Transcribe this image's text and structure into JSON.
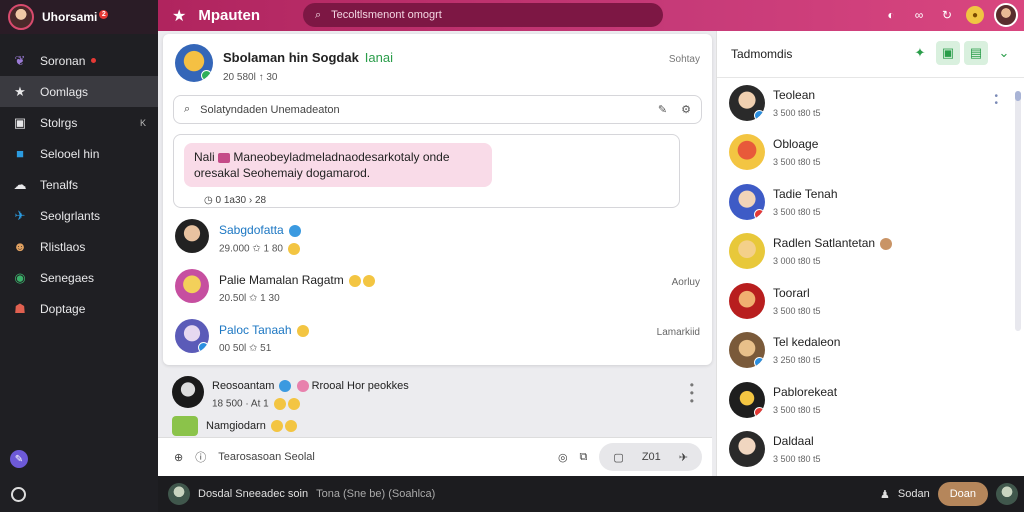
{
  "colors": {
    "accent": "#c63a78",
    "sidebar_bg": "#1f1f23",
    "green": "#2a9d4a",
    "link_blue": "#1c77c3"
  },
  "sidebar": {
    "user_name": "Uhorsami",
    "user_badge": "2",
    "items": [
      {
        "label": "Soronan",
        "icon": "feather-icon"
      },
      {
        "label": "Oomlags",
        "icon": "star-icon"
      },
      {
        "label": "Stolrgs",
        "icon": "image-icon",
        "tag": "K"
      },
      {
        "label": "Selooel hin",
        "icon": "app-icon"
      },
      {
        "label": "Tenalfs",
        "icon": "paw-icon"
      },
      {
        "label": "Seolgrlants",
        "icon": "bird-icon"
      },
      {
        "label": "Rlistlaos",
        "icon": "people-icon"
      },
      {
        "label": "Senegaes",
        "icon": "globe-icon"
      },
      {
        "label": "Doptage",
        "icon": "mask-icon"
      }
    ]
  },
  "topbar": {
    "title": "Mpauten",
    "search_placeholder": "Tecoltlsmenont omogrt"
  },
  "post": {
    "author": "Sbolaman hin Sogdak",
    "tag": "Ianai",
    "meta": "20 580l ↑ 30",
    "time": "Sohtay",
    "input_placeholder": "Solatyndaden Unemadeaton",
    "quote_lead": "Nali",
    "quote_text": "Maneobeyladmeladnaodesarkotaly onde oresakal Seohemaiy dogamarod.",
    "quote_meta": "0 1a30 › 28"
  },
  "comments": [
    {
      "name": "Sabgdofatta",
      "meta": "29.000 ✩ 1 80",
      "time": ""
    },
    {
      "name": "Palie Mamalan Ragatm",
      "meta": "20.50l ✩ 1 30",
      "time": "Aorluy"
    },
    {
      "name": "Paloc Tanaah",
      "meta": "00 50l ✩ 51",
      "time": "Lamarkiid"
    }
  ],
  "lower": [
    {
      "name": "Reosoantam",
      "extra": "Rrooal Hor peokkes",
      "meta": "18 500 · At 1"
    },
    {
      "name": "Namgiodarn",
      "extra": "",
      "meta": ""
    }
  ],
  "composer": {
    "placeholder": "Tearosasoan Seolal",
    "count": "Z01"
  },
  "rpanel": {
    "title": "Tadmomdis",
    "items": [
      {
        "name": "Teolean",
        "meta": "3 500 t80 t5"
      },
      {
        "name": "Obloage",
        "meta": "3 500 t80 t5"
      },
      {
        "name": "Tadie Tenah",
        "meta": "3 500 t80 t5"
      },
      {
        "name": "Radlen Satlantetan",
        "meta": "3 000 t80 t5"
      },
      {
        "name": "Toorarl",
        "meta": "3 500 t80 t5"
      },
      {
        "name": "Tel kedaleon",
        "meta": "3 250 t80 t5"
      },
      {
        "name": "Pablorekeat",
        "meta": "3 500 t80 t5"
      },
      {
        "name": "Daldaal",
        "meta": "3 500 t80 t5"
      }
    ]
  },
  "bottombar": {
    "text": "Dosdal Sneeadec soin",
    "extra": "Tona (Sne be) (Soahlca)",
    "right_label": "Sodan",
    "button_label": "Doan"
  }
}
